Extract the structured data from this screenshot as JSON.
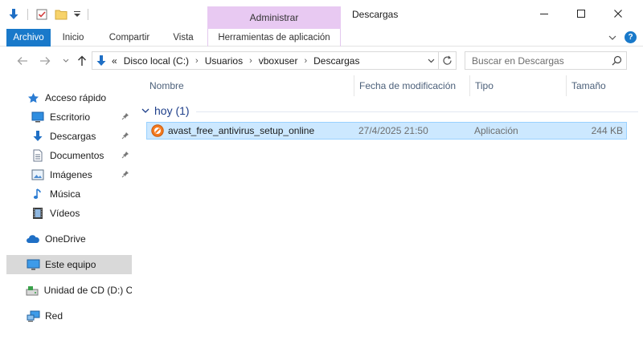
{
  "window": {
    "title": "Descargas",
    "context_tab_header": "Administrar",
    "controls": {
      "minimize": "—",
      "maximize": "☐",
      "close": "✕"
    }
  },
  "ribbon": {
    "tabs": [
      {
        "label": "Archivo"
      },
      {
        "label": "Inicio"
      },
      {
        "label": "Compartir"
      },
      {
        "label": "Vista"
      },
      {
        "label": "Herramientas de aplicación"
      }
    ],
    "help_label": "?"
  },
  "address": {
    "overflow": "«",
    "crumbs": [
      "Disco local (C:)",
      "Usuarios",
      "vboxuser",
      "Descargas"
    ],
    "crumb_separator": "›"
  },
  "search": {
    "placeholder": "Buscar en Descargas"
  },
  "sidebar": {
    "items": [
      {
        "label": "Acceso rápido",
        "icon": "star-icon"
      },
      {
        "label": "Escritorio",
        "icon": "desktop-icon",
        "pinned": true
      },
      {
        "label": "Descargas",
        "icon": "download-arrow-icon",
        "pinned": true
      },
      {
        "label": "Documentos",
        "icon": "document-icon",
        "pinned": true
      },
      {
        "label": "Imágenes",
        "icon": "image-icon",
        "pinned": true
      },
      {
        "label": "Música",
        "icon": "music-note-icon"
      },
      {
        "label": "Vídeos",
        "icon": "film-icon"
      },
      {
        "label": "OneDrive",
        "icon": "cloud-icon"
      },
      {
        "label": "Este equipo",
        "icon": "computer-icon",
        "selected": true
      },
      {
        "label": "Unidad de CD (D:) CE",
        "icon": "cd-drive-icon"
      },
      {
        "label": "Red",
        "icon": "network-icon"
      }
    ]
  },
  "columns": {
    "name": "Nombre",
    "date": "Fecha de modificación",
    "type": "Tipo",
    "size": "Tamaño"
  },
  "group": {
    "title": "hoy (1)"
  },
  "files": [
    {
      "name": "avast_free_antivirus_setup_online",
      "date": "27/4/2025 21:50",
      "type": "Aplicación",
      "size": "244 KB",
      "icon": "avast-app-icon"
    }
  ],
  "colors": {
    "accent": "#1979ca",
    "context_tab": "#e8c9f2",
    "selection_fill": "#cce8ff",
    "selection_border": "#99d1ff",
    "group_header": "#1e3f8a",
    "column_header": "#4c607a"
  }
}
